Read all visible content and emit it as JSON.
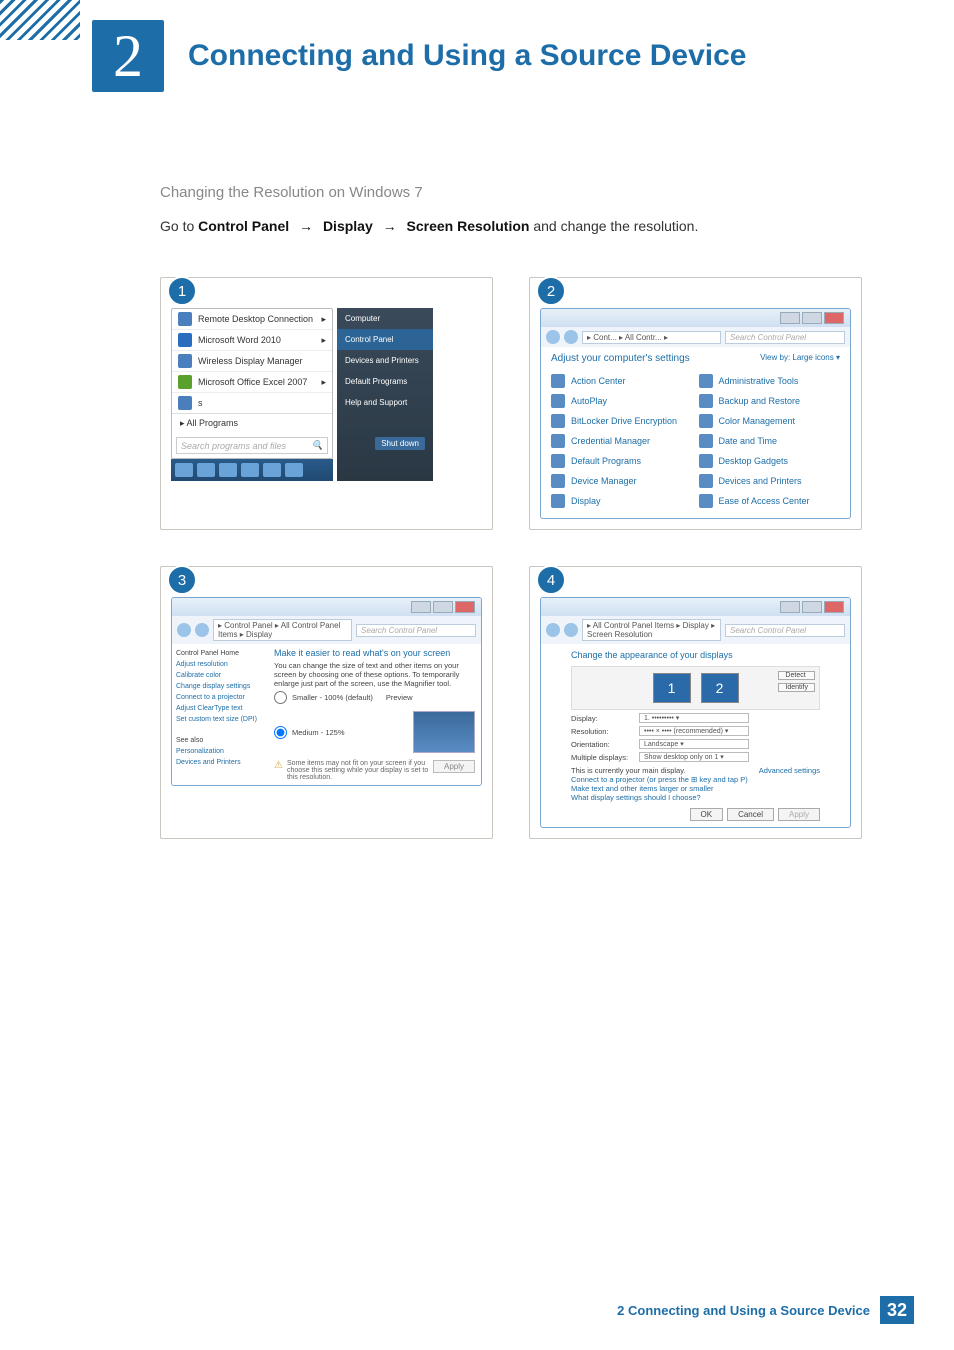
{
  "chapter": {
    "number": "2",
    "title": "Connecting and Using a Source Device"
  },
  "section": {
    "subheading": "Changing the Resolution on Windows 7",
    "instruction_prefix": "Go to ",
    "path": [
      "Control Panel",
      "Display",
      "Screen Resolution"
    ],
    "instruction_suffix": " and change the resolution.",
    "arrow": "→"
  },
  "step_badges": [
    "1",
    "2",
    "3",
    "4"
  ],
  "fig1": {
    "left_items": [
      "Remote Desktop Connection",
      "Microsoft Word 2010",
      "Wireless Display Manager",
      "Microsoft Office Excel 2007",
      "s"
    ],
    "all_programs": "All Programs",
    "search_placeholder": "Search programs and files",
    "right_items": [
      "Computer",
      "Control Panel",
      "Devices and Printers",
      "Default Programs",
      "Help and Support"
    ],
    "shutdown": "Shut down"
  },
  "fig2": {
    "crumb": "▸ Cont... ▸ All Contr... ▸",
    "search_placeholder": "Search Control Panel",
    "heading": "Adjust your computer's settings",
    "view": "View by:   Large icons ▾",
    "items_left": [
      "Action Center",
      "AutoPlay",
      "BitLocker Drive Encryption",
      "Credential Manager",
      "Default Programs",
      "Device Manager",
      "Display"
    ],
    "items_right": [
      "Administrative Tools",
      "Backup and Restore",
      "Color Management",
      "Date and Time",
      "Desktop Gadgets",
      "Devices and Printers",
      "Ease of Access Center"
    ]
  },
  "fig3": {
    "crumb": "▸ Control Panel ▸ All Control Panel Items ▸ Display",
    "search_placeholder": "Search Control Panel",
    "sidebar": {
      "home": "Control Panel Home",
      "links": [
        "Adjust resolution",
        "Calibrate color",
        "Change display settings",
        "Connect to a projector",
        "Adjust ClearType text",
        "Set custom text size (DPI)"
      ],
      "seealso": "See also",
      "seealso_links": [
        "Personalization",
        "Devices and Printers"
      ]
    },
    "main": {
      "title": "Make it easier to read what's on your screen",
      "desc": "You can change the size of text and other items on your screen by choosing one of these options. To temporarily enlarge just part of the screen, use the Magnifier tool.",
      "opt1": "Smaller - 100% (default)",
      "opt1_note": "Preview",
      "opt2": "Medium - 125%",
      "warn": "Some items may not fit on your screen if you choose this setting while your display is set to this resolution.",
      "apply": "Apply"
    }
  },
  "fig4": {
    "crumb": "▸ All Control Panel Items ▸ Display ▸ Screen Resolution",
    "search_placeholder": "Search Control Panel",
    "title": "Change the appearance of your displays",
    "detect": "Detect",
    "identify": "Identify",
    "mon1": "1",
    "mon2": "2",
    "fields": {
      "display": {
        "k": "Display:",
        "v": "1. •••••••••  ▾"
      },
      "resolution": {
        "k": "Resolution:",
        "v": "•••• × •••• (recommended) ▾"
      },
      "orientation": {
        "k": "Orientation:",
        "v": "Landscape  ▾"
      },
      "multiple": {
        "k": "Multiple displays:",
        "v": "Show desktop only on 1 ▾"
      }
    },
    "main_note": "This is currently your main display.",
    "adv": "Advanced settings",
    "links": [
      "Connect to a projector (or press the ⊞ key and tap P)",
      "Make text and other items larger or smaller",
      "What display settings should I choose?"
    ],
    "buttons": {
      "ok": "OK",
      "cancel": "Cancel",
      "apply": "Apply"
    }
  },
  "footer": {
    "label": "2 Connecting and Using a Source Device",
    "page": "32"
  }
}
